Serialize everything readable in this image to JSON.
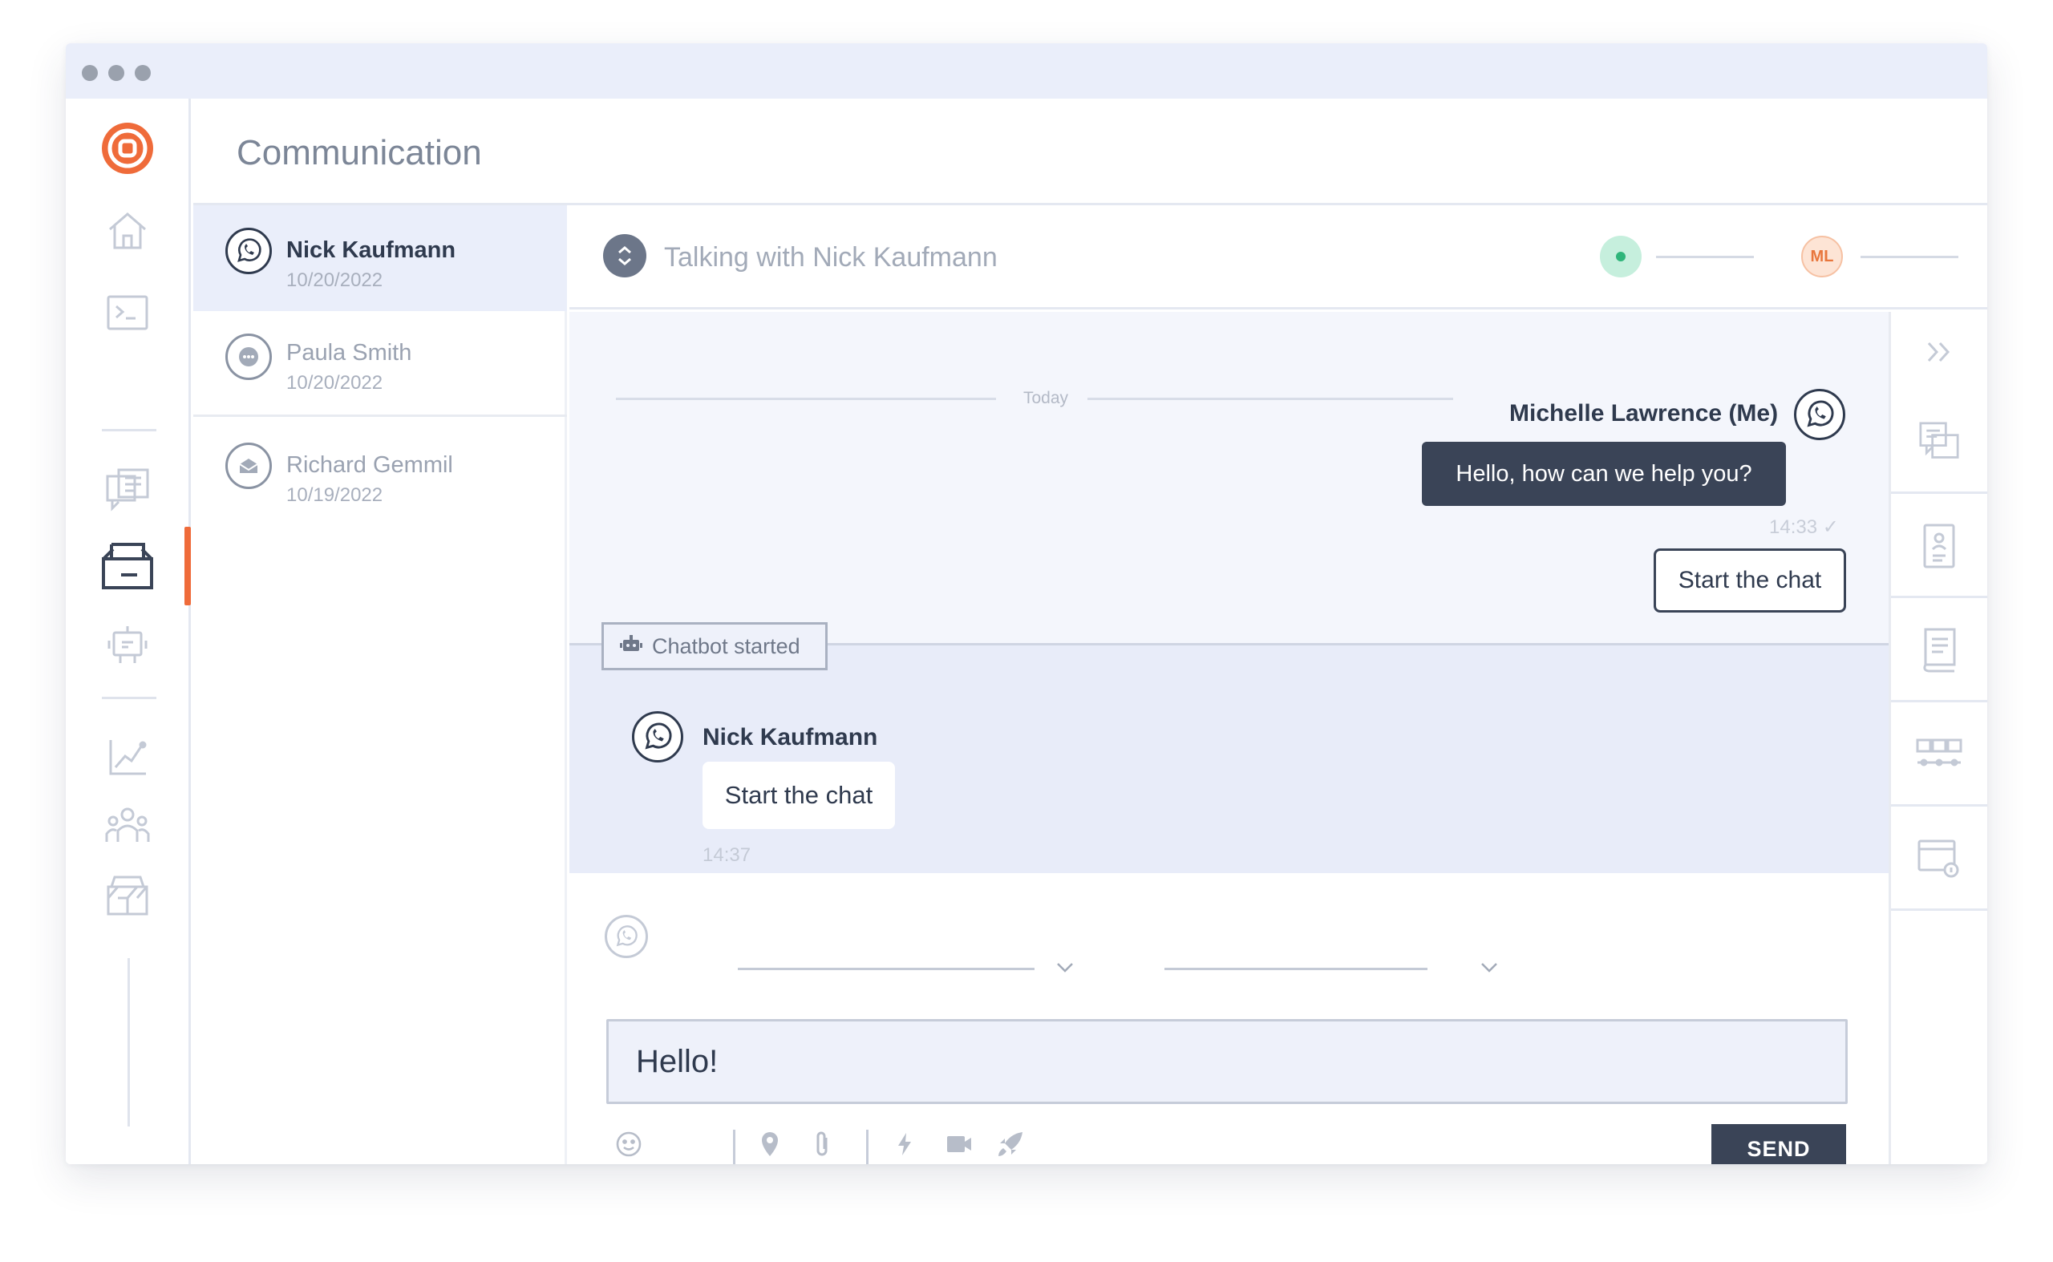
{
  "app": {
    "title": "Communication",
    "brand_color": "#ef6b3a",
    "window_dots": [
      "dot",
      "dot",
      "dot"
    ]
  },
  "rail": {
    "icons": [
      "logo-icon",
      "home-icon",
      "terminal-icon",
      "messages-icon",
      "inbox-icon",
      "bot-icon",
      "analytics-icon",
      "team-icon",
      "store-icon"
    ],
    "active": "inbox-icon"
  },
  "conversations": [
    {
      "name": "Nick Kaufmann",
      "date": "10/20/2022",
      "channel_icon": "whatsapp-icon",
      "active": true
    },
    {
      "name": "Paula Smith",
      "date": "10/20/2022",
      "channel_icon": "chat-bubble-icon",
      "active": false
    },
    {
      "name": "Richard Gemmil",
      "date": "10/19/2022",
      "channel_icon": "email-icon",
      "active": false
    }
  ],
  "chat": {
    "header_title": "Talking with Nick Kaufmann",
    "agent_initials": "ML",
    "status_color": "#2fb57a",
    "divider_label": "Today",
    "me": {
      "name": "Michelle Lawrence (Me)",
      "message": "Hello, how can we help you?",
      "time": "14:33 ✓",
      "button_label": "Start the chat"
    },
    "bot_badge": "Chatbot started",
    "customer": {
      "name": "Nick Kaufmann",
      "message": "Start the chat",
      "time": "14:37"
    }
  },
  "right_sidebar": {
    "icons": [
      "collapse-icon",
      "conversation-icon",
      "contact-card-icon",
      "notes-icon",
      "templates-icon",
      "browser-info-icon"
    ]
  },
  "composer": {
    "input_value": "Hello!",
    "send_label": "SEND",
    "tools": [
      "emoji-icon",
      "location-icon",
      "attachment-icon",
      "flash-icon",
      "video-icon",
      "rocket-icon"
    ]
  }
}
